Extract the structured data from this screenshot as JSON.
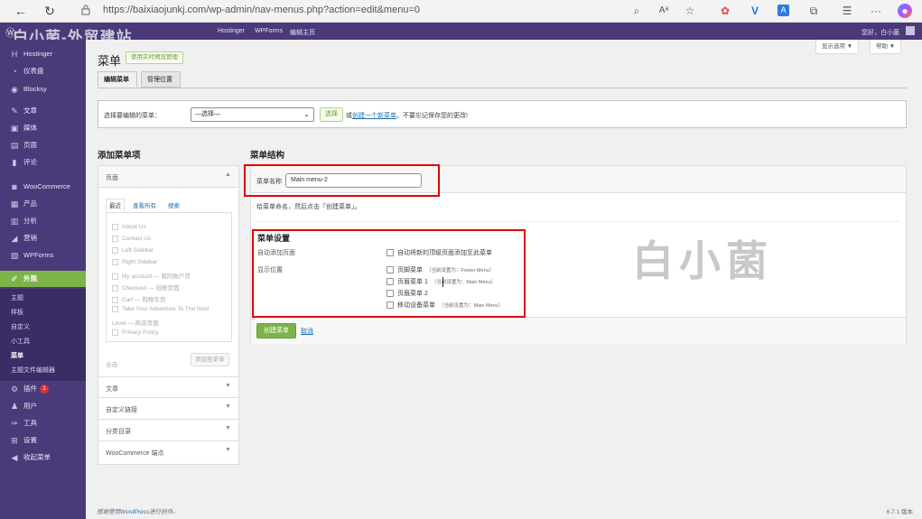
{
  "browser": {
    "url": "https://baixiaojunkj.com/wp-admin/nav-menus.php?action=edit&menu=0"
  },
  "adminbar": {
    "items": [
      "Hostinger",
      "WPForms",
      "编辑主页"
    ],
    "greeting": "您好，白小菌"
  },
  "watermark": {
    "top_left": "白小菌-外贸建站",
    "big": "白小菌"
  },
  "sidebar": {
    "items": [
      {
        "label": "Hostinger",
        "icon": "h-icon"
      },
      {
        "label": "仪表盘",
        "icon": "dashboard-icon"
      },
      {
        "label": "Blocksy",
        "icon": "blocksy-icon"
      },
      {
        "label": "文章",
        "icon": "pin-icon"
      },
      {
        "label": "媒体",
        "icon": "media-icon"
      },
      {
        "label": "页面",
        "icon": "page-icon"
      },
      {
        "label": "评论",
        "icon": "comment-icon"
      },
      {
        "label": "WooCommerce",
        "icon": "woo-icon"
      },
      {
        "label": "产品",
        "icon": "product-icon"
      },
      {
        "label": "分析",
        "icon": "chart-icon"
      },
      {
        "label": "营销",
        "icon": "megaphone-icon"
      },
      {
        "label": "WPForms",
        "icon": "form-icon"
      },
      {
        "label": "外观",
        "icon": "brush-icon"
      }
    ],
    "appearance_sub": [
      "主题",
      "样板",
      "自定义",
      "小工具",
      "菜单",
      "主题文件编辑器"
    ],
    "bottom_items": [
      {
        "label": "插件",
        "icon": "plugin-icon",
        "badge": "1"
      },
      {
        "label": "用户",
        "icon": "user-icon"
      },
      {
        "label": "工具",
        "icon": "wrench-icon"
      },
      {
        "label": "设置",
        "icon": "settings-icon"
      },
      {
        "label": "收起菜单",
        "icon": "collapse-icon"
      }
    ]
  },
  "page": {
    "title": "菜单",
    "live_button": "使用实时预览管理",
    "screen_options": "显示选项 ▼",
    "help": "帮助 ▼",
    "tabs": [
      "编辑菜单",
      "管理位置"
    ]
  },
  "select_menu": {
    "label": "选择要编辑的菜单：",
    "value": "—选择—",
    "select_button": "选择",
    "or_text": "或",
    "create_link": "创建一个新菜单",
    "save_hint": "。不要忘记保存您的更改!"
  },
  "add_items": {
    "heading": "添加菜单项",
    "pages_title": "页面",
    "subtabs": [
      "最近",
      "查看所有",
      "搜索"
    ],
    "pages": [
      "About Us",
      "Contact Us",
      "Left Sidebar",
      "Right Sidebar",
      "My account — 我的账户页",
      "Checkout — 结帐页面",
      "Cart — 购物车页",
      "Take Your Adventure To The Next",
      "Level — 商店页面",
      "Privacy Policy"
    ],
    "select_all": "全选",
    "add_button": "添加至菜单",
    "sections": [
      "文章",
      "自定义链接",
      "分类目录",
      "WooCommerce 端点"
    ]
  },
  "structure": {
    "heading": "菜单结构",
    "name_label": "菜单名称",
    "name_value": "Main menu-2",
    "hint": "给菜单命名，然后点击「创建菜单」。",
    "settings_title": "菜单设置",
    "auto_add_label": "自动添加页面",
    "auto_add_option": "自动将新的顶级页面添加至此菜单",
    "location_label": "显示位置",
    "locations": [
      {
        "name": "页脚菜单",
        "note": "（当前设置为：Footer Menu）"
      },
      {
        "name": "页眉菜单 1",
        "note": "（当前设置为：Main Menu）"
      },
      {
        "name": "页眉菜单 2",
        "note": ""
      },
      {
        "name": "移动设备菜单",
        "note": "（当前设置为：Main Menu）"
      }
    ],
    "create_button": "创建菜单",
    "cancel": "取消"
  },
  "footer": {
    "thanks_prefix": "感谢使用",
    "wp_link": "WordPress",
    "thanks_suffix": "进行创作。",
    "version": "6.7.1 版本"
  },
  "colors": {
    "admin_purple": "#4a3a7a",
    "accent_green": "#7cb44a",
    "highlight_red": "#e00000"
  }
}
